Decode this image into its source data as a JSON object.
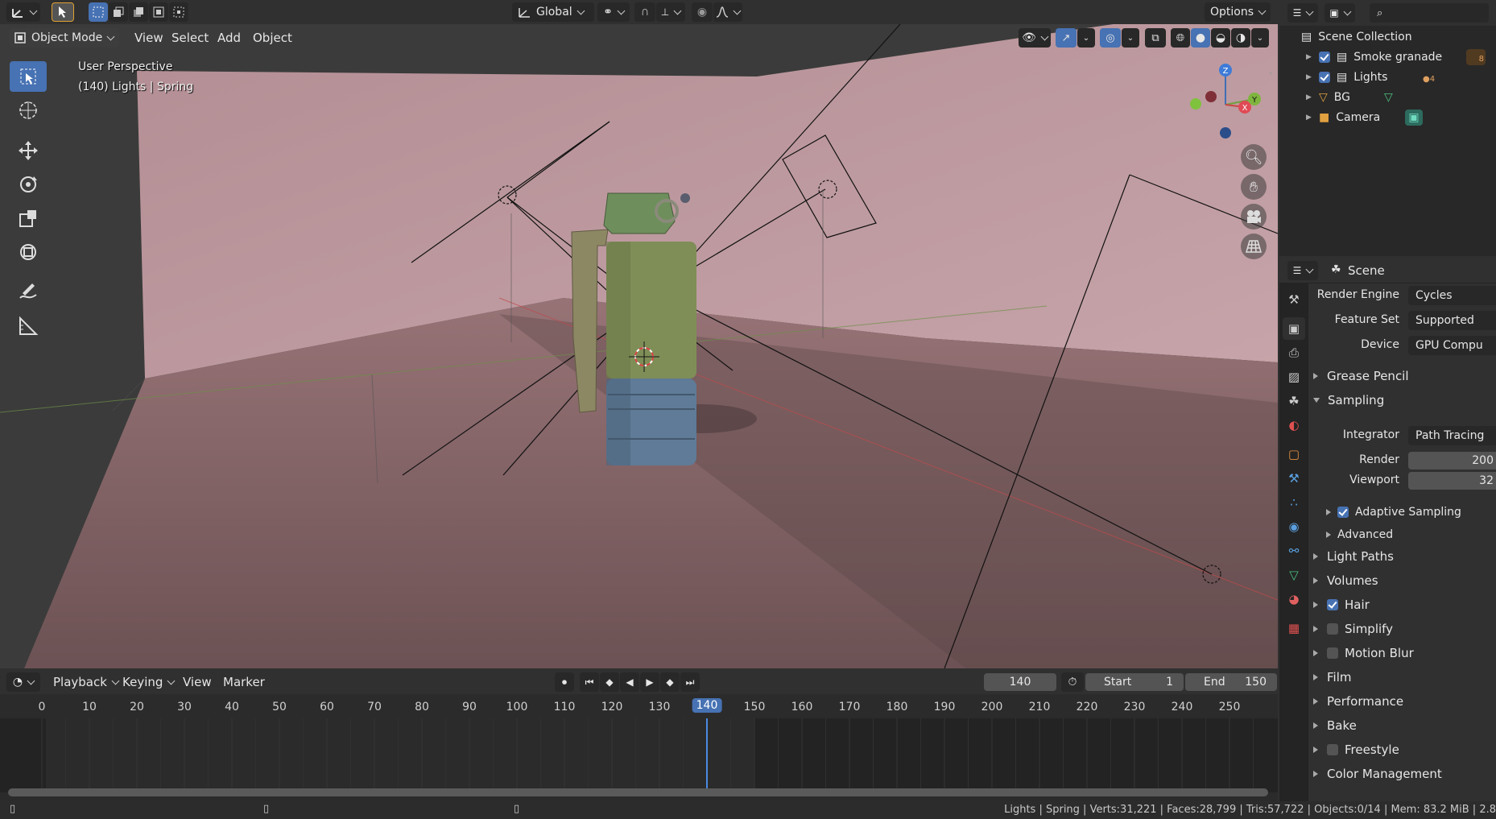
{
  "header": {
    "transform_orientation": "Global",
    "options_label": "Options"
  },
  "viewport": {
    "mode_label": "Object Mode",
    "menus": [
      "View",
      "Select",
      "Add",
      "Object"
    ],
    "perspective_label": "User Perspective",
    "object_info": "(140) Lights | Spring",
    "gizmo_axes": {
      "x": "X",
      "y": "Y",
      "z": "Z"
    },
    "colors": {
      "wall": "#b48f95",
      "floor": "#7c5e60",
      "grenade_body": "#7e8d58",
      "grenade_base": "#5e7a96"
    }
  },
  "timeline": {
    "menus": [
      "Playback",
      "Keying",
      "View",
      "Marker"
    ],
    "current_frame": "140",
    "start_label": "Start",
    "start_value": "1",
    "end_label": "End",
    "end_value": "150",
    "ticks": [
      "0",
      "10",
      "20",
      "30",
      "40",
      "50",
      "60",
      "70",
      "80",
      "90",
      "100",
      "110",
      "120",
      "130",
      "140",
      "150",
      "160",
      "170",
      "180",
      "190",
      "200",
      "210",
      "220",
      "230",
      "240",
      "250"
    ],
    "current_tick": "140"
  },
  "status": {
    "text": "Lights | Spring | Verts:31,221 | Faces:28,799 | Tris:57,722 | Objects:0/14 | Mem: 83.2 MiB | 2.8"
  },
  "outliner": {
    "root": "Scene Collection",
    "items": [
      {
        "label": "Smoke granade",
        "checked": true,
        "badge": "8"
      },
      {
        "label": "Lights",
        "checked": true,
        "badge": "4"
      },
      {
        "label": "BG",
        "checked": false,
        "badge": ""
      },
      {
        "label": "Camera",
        "checked": false,
        "badge": ""
      }
    ]
  },
  "properties": {
    "context": "Scene",
    "render_engine_label": "Render Engine",
    "render_engine_value": "Cycles",
    "feature_set_label": "Feature Set",
    "feature_set_value": "Supported",
    "device_label": "Device",
    "device_value": "GPU Compu",
    "grease_pencil": "Grease Pencil",
    "sampling": "Sampling",
    "integrator_label": "Integrator",
    "integrator_value": "Path Tracing",
    "render_label": "Render",
    "render_value": "200",
    "viewport_label": "Viewport",
    "viewport_value": "32",
    "adaptive_sampling": "Adaptive Sampling",
    "advanced": "Advanced",
    "light_paths": "Light Paths",
    "volumes": "Volumes",
    "hair": "Hair",
    "simplify": "Simplify",
    "motion_blur": "Motion Blur",
    "film": "Film",
    "performance": "Performance",
    "bake": "Bake",
    "freestyle": "Freestyle",
    "color_management": "Color Management"
  }
}
